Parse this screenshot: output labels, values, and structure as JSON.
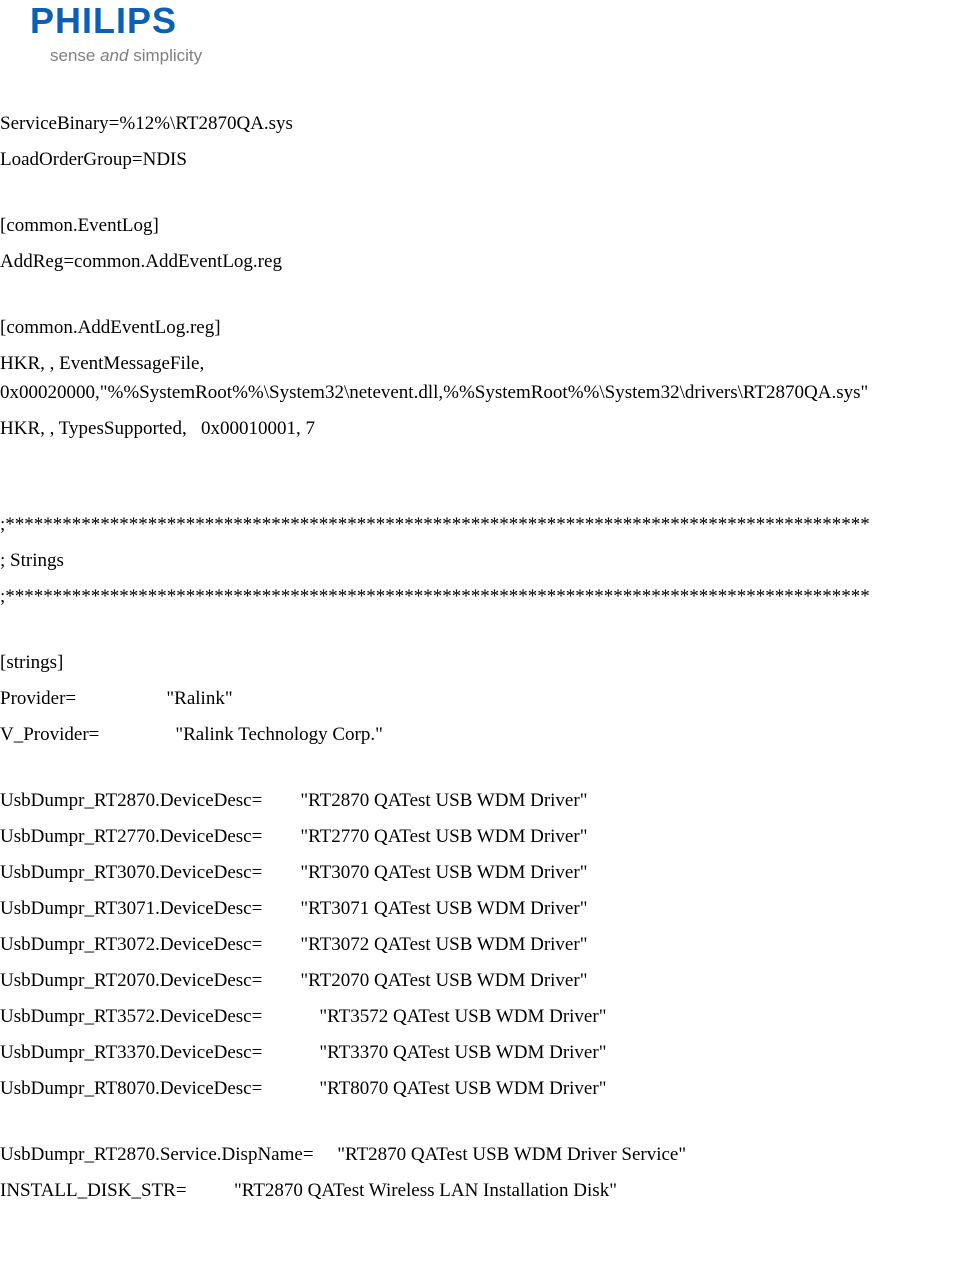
{
  "logo": {
    "brand": "PHILIPS",
    "tagline_prefix": "sense ",
    "tagline_and": "and",
    "tagline_suffix": " simplicity"
  },
  "lines": {
    "l1": "ServiceBinary=%12%\\RT2870QA.sys",
    "l2": "LoadOrderGroup=NDIS",
    "l3": "[common.EventLog]",
    "l4": "AddReg=common.AddEventLog.reg",
    "l5": "[common.AddEventLog.reg]",
    "l6": "HKR, , EventMessageFile,",
    "l7": "0x00020000,\"%%SystemRoot%%\\System32\\netevent.dll,%%SystemRoot%%\\System32\\drivers\\RT2870QA.sys\"",
    "l8": "HKR, , TypesSupported,   0x00010001, 7",
    "l9": ";*******************************************************************************************",
    "l10": "; Strings",
    "l11": ";*******************************************************************************************",
    "l12": "[strings]",
    "l13": "Provider=                   \"Ralink\"",
    "l14": "V_Provider=                \"Ralink Technology Corp.\"",
    "l15": "UsbDumpr_RT2870.DeviceDesc=        \"RT2870 QATest USB WDM Driver\"",
    "l16": "UsbDumpr_RT2770.DeviceDesc=        \"RT2770 QATest USB WDM Driver\"",
    "l17": "UsbDumpr_RT3070.DeviceDesc=        \"RT3070 QATest USB WDM Driver\"",
    "l18": "UsbDumpr_RT3071.DeviceDesc=        \"RT3071 QATest USB WDM Driver\"",
    "l19": "UsbDumpr_RT3072.DeviceDesc=        \"RT3072 QATest USB WDM Driver\"",
    "l20": "UsbDumpr_RT2070.DeviceDesc=        \"RT2070 QATest USB WDM Driver\"",
    "l21": "UsbDumpr_RT3572.DeviceDesc=            \"RT3572 QATest USB WDM Driver\"",
    "l22": "UsbDumpr_RT3370.DeviceDesc=            \"RT3370 QATest USB WDM Driver\"",
    "l23": "UsbDumpr_RT8070.DeviceDesc=            \"RT8070 QATest USB WDM Driver\"",
    "l24": "UsbDumpr_RT2870.Service.DispName=     \"RT2870 QATest USB WDM Driver Service\"",
    "l25": "INSTALL_DISK_STR=          \"RT2870 QATest Wireless LAN Installation Disk\""
  }
}
